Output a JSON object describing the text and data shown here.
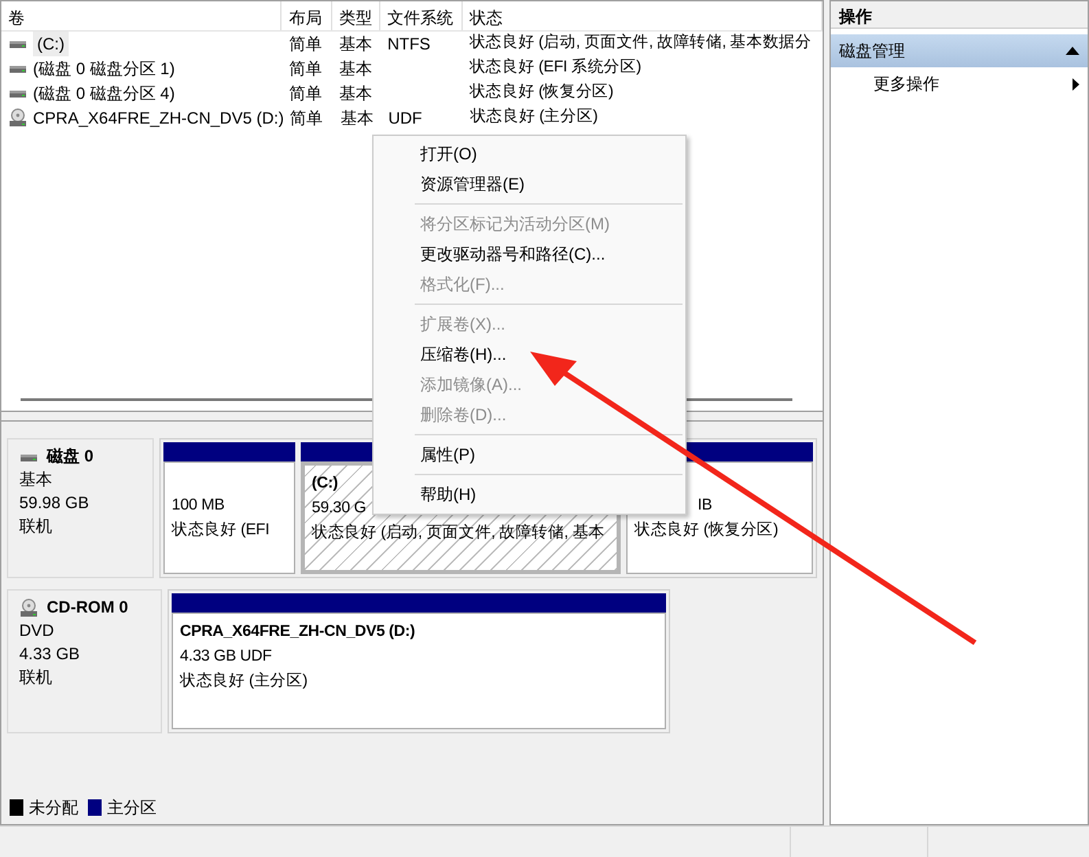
{
  "volume_table": {
    "columns": [
      "卷",
      "布局",
      "类型",
      "文件系统",
      "状态"
    ],
    "rows": [
      {
        "kind": "disk",
        "cells": [
          "(C:)",
          "简单",
          "基本",
          "NTFS",
          "状态良好 (启动, 页面文件, 故障转储, 基本数据分"
        ],
        "selected": true
      },
      {
        "kind": "disk",
        "cells": [
          "(磁盘 0 磁盘分区 1)",
          "简单",
          "基本",
          "",
          "状态良好 (EFI 系统分区)"
        ],
        "selected": false
      },
      {
        "kind": "disk",
        "cells": [
          "(磁盘 0 磁盘分区 4)",
          "简单",
          "基本",
          "",
          "状态良好 (恢复分区)"
        ],
        "selected": false
      },
      {
        "kind": "cdrom",
        "cells": [
          "CPRA_X64FRE_ZH-CN_DV5 (D:)",
          "简单",
          "基本",
          "UDF",
          "状态良好 (主分区)"
        ],
        "selected": false
      }
    ]
  },
  "disks": [
    {
      "kind": "disk",
      "name": "磁盘 0",
      "lines": [
        "基本",
        "59.98 GB",
        "联机"
      ],
      "partitions": [
        {
          "size": "100 MB",
          "status": "状态良好 (EFI",
          "selected": false
        },
        {
          "name": "(C:)",
          "size": "59.30 G",
          "status": "状态良好 (启动, 页面文件, 故障转储, 基本",
          "selected": true
        },
        {
          "size": "IB",
          "status": "状态良好 (恢复分区)",
          "selected": false
        }
      ]
    },
    {
      "kind": "cdrom",
      "name": "CD-ROM 0",
      "lines": [
        "DVD",
        "4.33 GB",
        "联机"
      ],
      "partitions": [
        {
          "name": "CPRA_X64FRE_ZH-CN_DV5  (D:)",
          "size": "4.33 GB UDF",
          "status": "状态良好 (主分区)",
          "selected": false
        }
      ]
    }
  ],
  "legend": [
    {
      "label": "未分配",
      "color": "#000000"
    },
    {
      "label": "主分区",
      "color": "#000080"
    }
  ],
  "context_menu": [
    {
      "kind": "item",
      "label": "打开(O)",
      "disabled": false
    },
    {
      "kind": "item",
      "label": "资源管理器(E)",
      "disabled": false
    },
    {
      "kind": "separator"
    },
    {
      "kind": "item",
      "label": "将分区标记为活动分区(M)",
      "disabled": true
    },
    {
      "kind": "item",
      "label": "更改驱动器号和路径(C)...",
      "disabled": false
    },
    {
      "kind": "item",
      "label": "格式化(F)...",
      "disabled": true
    },
    {
      "kind": "separator"
    },
    {
      "kind": "item",
      "label": "扩展卷(X)...",
      "disabled": true
    },
    {
      "kind": "item",
      "label": "压缩卷(H)...",
      "disabled": false
    },
    {
      "kind": "item",
      "label": "添加镜像(A)...",
      "disabled": true
    },
    {
      "kind": "item",
      "label": "删除卷(D)...",
      "disabled": true
    },
    {
      "kind": "separator"
    },
    {
      "kind": "item",
      "label": "属性(P)",
      "disabled": false
    },
    {
      "kind": "separator"
    },
    {
      "kind": "item",
      "label": "帮助(H)",
      "disabled": false
    }
  ],
  "actions": {
    "title": "操作",
    "section": {
      "label": "磁盘管理",
      "expanded": true
    },
    "items": [
      {
        "label": "更多操作"
      }
    ]
  }
}
